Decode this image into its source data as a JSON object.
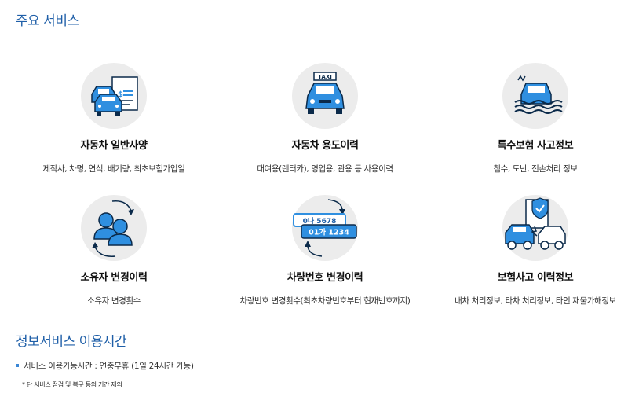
{
  "sections": {
    "main_title": "주요 서비스",
    "hours_title": "정보서비스 이용시간"
  },
  "services": [
    {
      "title": "자동차 일반사양",
      "desc": "제작사, 차명, 연식, 배기량, 최초보험가입일",
      "icon": "car-document-icon"
    },
    {
      "title": "자동차 용도이력",
      "desc": "대여용(렌터카), 영업용, 관용 등 사용이력",
      "icon": "taxi-icon"
    },
    {
      "title": "특수보험 사고정보",
      "desc": "침수, 도난, 전손처리 정보",
      "icon": "flooded-car-icon"
    },
    {
      "title": "소유자 변경이력",
      "desc": "소유자 변경횟수",
      "icon": "owner-change-icon"
    },
    {
      "title": "차량번호 변경이력",
      "desc": "차량번호 변경횟수(최초차량번호부터 현재번호까지)",
      "icon": "plate-change-icon"
    },
    {
      "title": "보험사고 이력정보",
      "desc": "내차 처리정보, 타차 처리정보, 타인 재물가해정보",
      "icon": "car-crash-icon"
    }
  ],
  "plates": {
    "top": "0나 5678",
    "bottom": "01가 1234"
  },
  "taxi_sign": "TAXI",
  "hours": {
    "item": "서비스 이용가능시간 : 연중무휴 (1일 24시간 가능)",
    "note": "* 단 서비스 점검 및 복구 등의 기간 제외"
  },
  "colors": {
    "accent": "#1f5fa8",
    "icon_blue": "#2f8fe0",
    "icon_dark": "#0b2a4a",
    "circle": "#ececec"
  }
}
